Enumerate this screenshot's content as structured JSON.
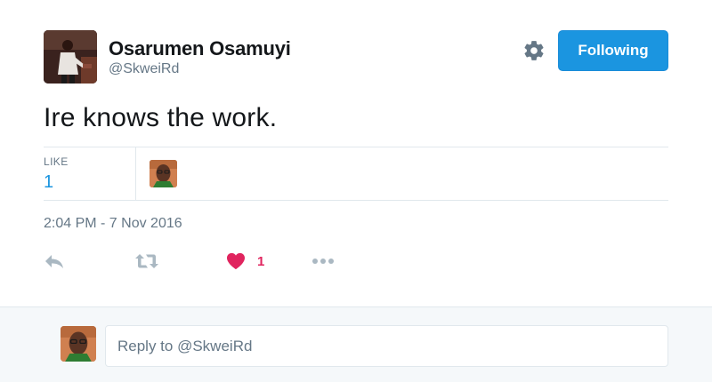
{
  "author": {
    "name": "Osarumen Osamuyi",
    "handle": "@SkweiRd"
  },
  "follow_button": {
    "label": "Following"
  },
  "tweet": {
    "text": "Ire knows the work.",
    "timestamp": "2:04 PM - 7 Nov 2016"
  },
  "stats": {
    "likes_label": "LIKE",
    "likes_value": "1"
  },
  "actions": {
    "reply_icon": "reply-icon",
    "retweet_icon": "retweet-icon",
    "like_icon": "heart-icon",
    "like_count": "1",
    "more_icon": "more-icon"
  },
  "reply_bar": {
    "placeholder": "Reply to @SkweiRd"
  },
  "colors": {
    "accent": "#1b95e0",
    "like": "#e0245e",
    "muted": "#657786",
    "border": "#e1e8ed",
    "reply_bg": "#f5f8fa"
  }
}
